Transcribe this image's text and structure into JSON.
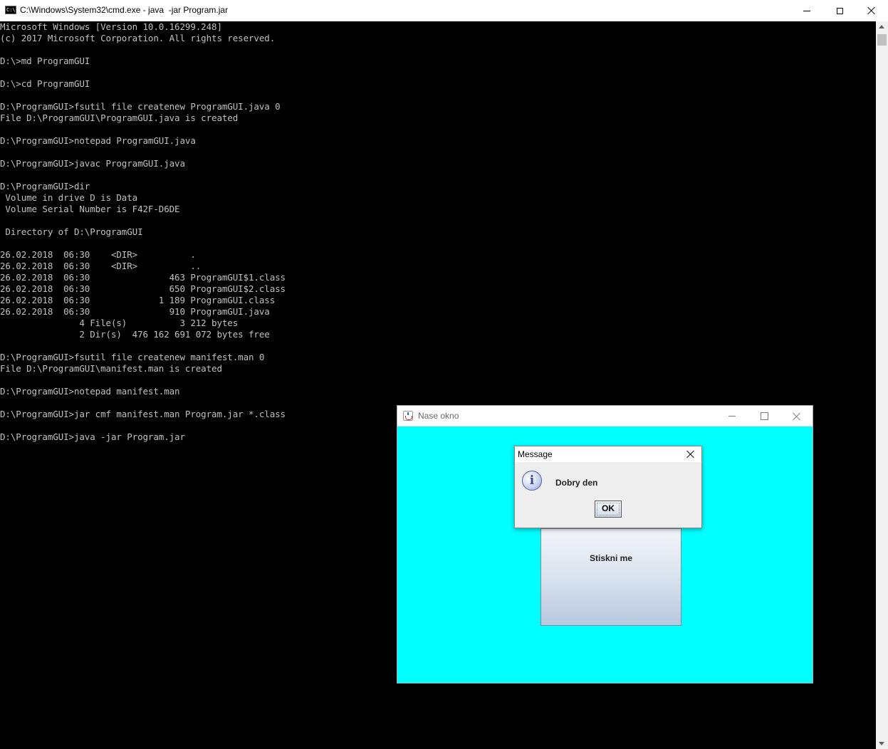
{
  "cmd_window": {
    "icon_text": "C:\\",
    "title": "C:\\Windows\\System32\\cmd.exe - java  -jar Program.jar",
    "console_lines": [
      "Microsoft Windows [Version 10.0.16299.248]",
      "(c) 2017 Microsoft Corporation. All rights reserved.",
      "",
      "D:\\>md ProgramGUI",
      "",
      "D:\\>cd ProgramGUI",
      "",
      "D:\\ProgramGUI>fsutil file createnew ProgramGUI.java 0",
      "File D:\\ProgramGUI\\ProgramGUI.java is created",
      "",
      "D:\\ProgramGUI>notepad ProgramGUI.java",
      "",
      "D:\\ProgramGUI>javac ProgramGUI.java",
      "",
      "D:\\ProgramGUI>dir",
      " Volume in drive D is Data",
      " Volume Serial Number is F42F-D6DE",
      "",
      " Directory of D:\\ProgramGUI",
      "",
      "26.02.2018  06:30    <DIR>          .",
      "26.02.2018  06:30    <DIR>          ..",
      "26.02.2018  06:30               463 ProgramGUI$1.class",
      "26.02.2018  06:30               650 ProgramGUI$2.class",
      "26.02.2018  06:30             1 189 ProgramGUI.class",
      "26.02.2018  06:30               910 ProgramGUI.java",
      "               4 File(s)          3 212 bytes",
      "               2 Dir(s)  476 162 691 072 bytes free",
      "",
      "D:\\ProgramGUI>fsutil file createnew manifest.man 0",
      "File D:\\ProgramGUI\\manifest.man is created",
      "",
      "D:\\ProgramGUI>notepad manifest.man",
      "",
      "D:\\ProgramGUI>jar cmf manifest.man Program.jar *.class",
      "",
      "D:\\ProgramGUI>java -jar Program.jar"
    ]
  },
  "java_window": {
    "title": "Nase okno",
    "button_label": "Stiskni me",
    "background_color": "#00ffff"
  },
  "dialog": {
    "title": "Message",
    "message": "Dobry den",
    "icon": "information-icon",
    "icon_glyph": "i",
    "ok_label": "OK"
  }
}
